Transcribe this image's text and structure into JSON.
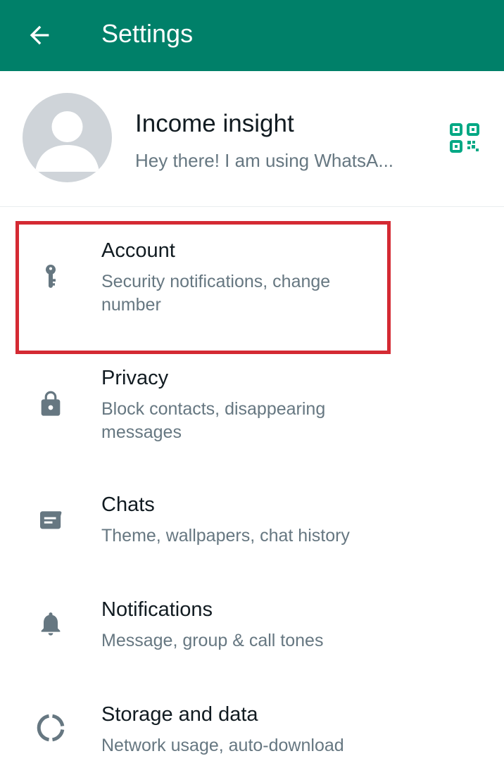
{
  "header": {
    "title": "Settings",
    "back_icon": "arrow-left-icon",
    "background": "#008069"
  },
  "profile": {
    "name": "Income insight",
    "status": "Hey there! I am using WhatsA...",
    "qr_icon": "qr-code-icon",
    "accent": "#00a884"
  },
  "settings": {
    "items": [
      {
        "title": "Account",
        "subtitle": "Security notifications, change number",
        "icon": "key-icon"
      },
      {
        "title": "Privacy",
        "subtitle": "Block contacts, disappearing messages",
        "icon": "lock-icon"
      },
      {
        "title": "Chats",
        "subtitle": "Theme, wallpapers, chat history",
        "icon": "chat-icon"
      },
      {
        "title": "Notifications",
        "subtitle": "Message, group & call tones",
        "icon": "bell-icon"
      },
      {
        "title": "Storage and data",
        "subtitle": "Network usage, auto-download",
        "icon": "storage-circle-icon"
      }
    ]
  },
  "highlight": {
    "target": "Account",
    "color": "#d42a33"
  }
}
